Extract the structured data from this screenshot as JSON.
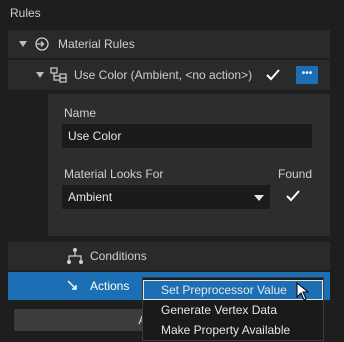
{
  "header": {
    "title": "Rules"
  },
  "material_rules": {
    "label": "Material Rules"
  },
  "use_color": {
    "label": "Use Color (Ambient, <no action>)",
    "more_button": "•••"
  },
  "card": {
    "name_label": "Name",
    "name_value": "Use Color",
    "looks_for_label": "Material Looks For",
    "looks_for_value": "Ambient",
    "found_label": "Found"
  },
  "conditions": {
    "label": "Conditions"
  },
  "actions": {
    "label": "Actions"
  },
  "add_button": {
    "label": "Add"
  },
  "context_menu": {
    "items": [
      "Set Preprocessor Value",
      "Generate Vertex Data",
      "Make Property Available"
    ]
  },
  "colors": {
    "accent": "#1c6fb5",
    "background": "#1e1e1e",
    "panel": "#2a2a2a"
  }
}
